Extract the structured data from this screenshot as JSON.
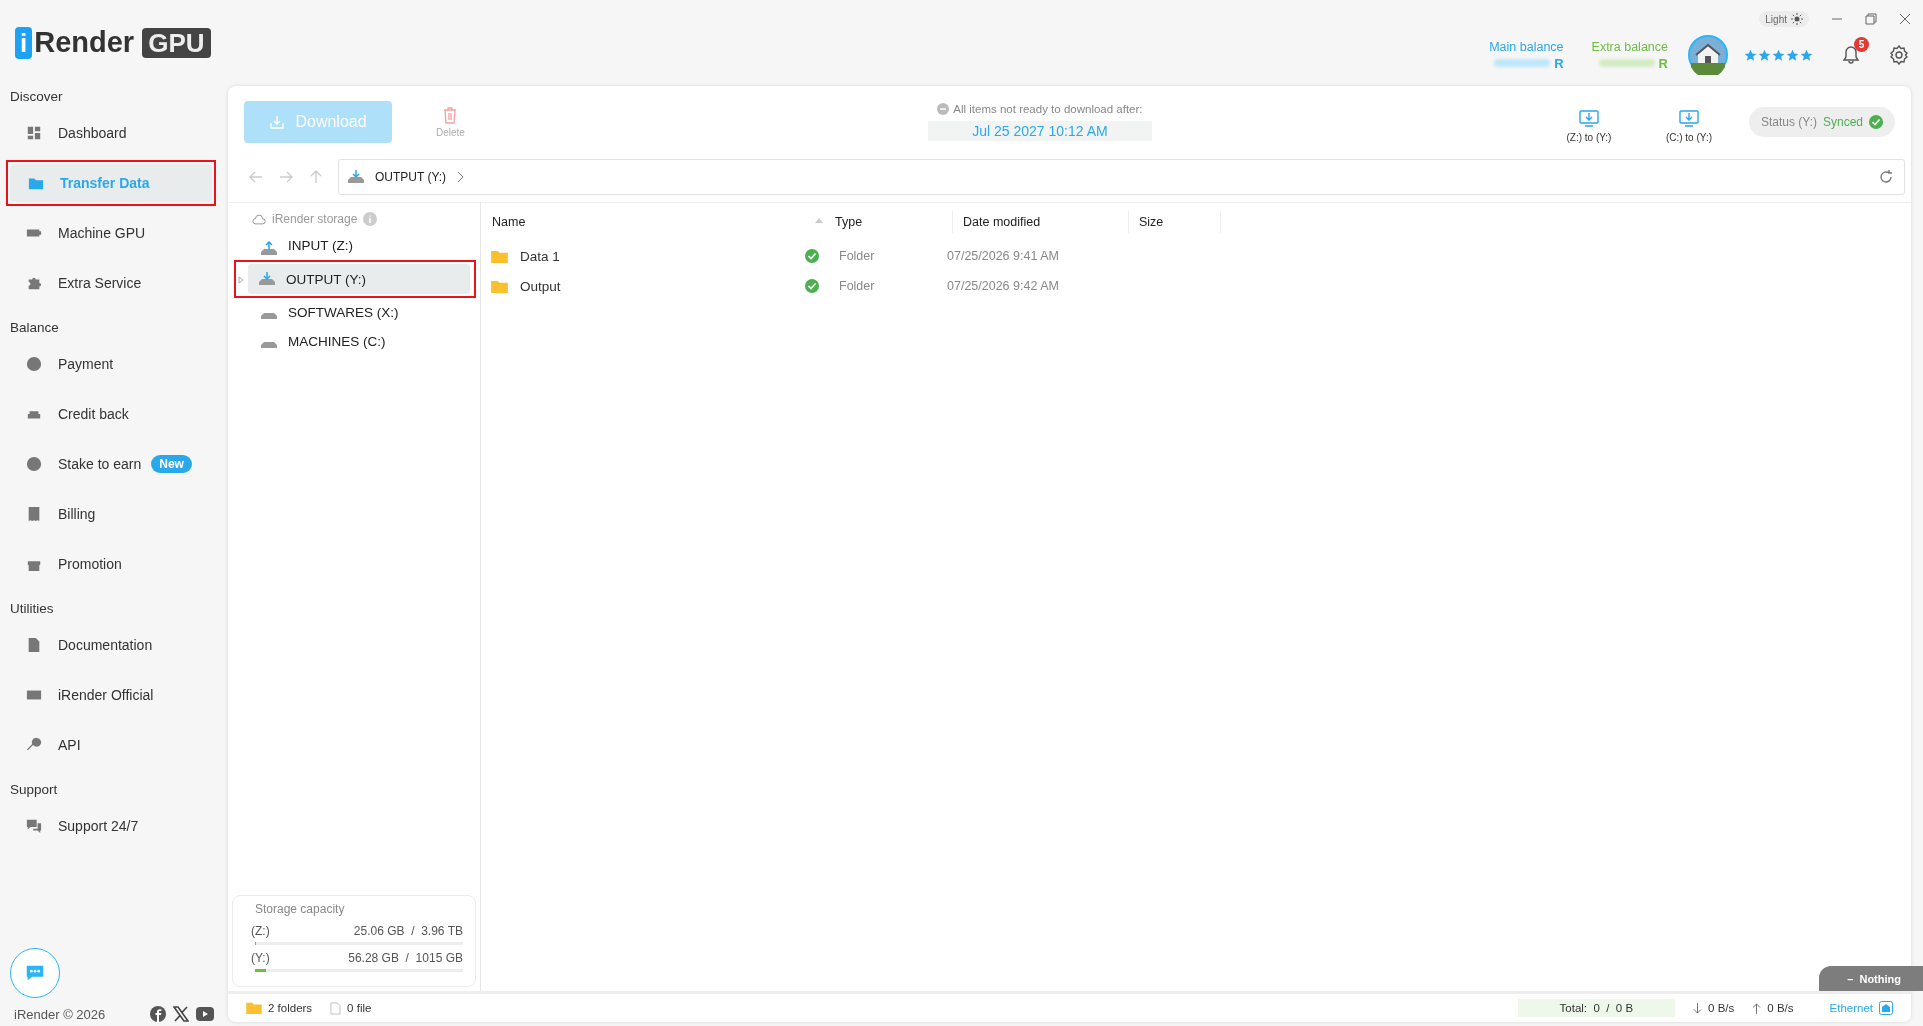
{
  "brand": {
    "logo_letter": "i",
    "logo_word": "Render",
    "logo_badge": "GPU"
  },
  "window_controls": {
    "theme_label": "Light"
  },
  "header": {
    "main_balance_label": "Main balance",
    "main_currency": "R",
    "extra_balance_label": "Extra balance",
    "extra_currency": "R",
    "stars": 5,
    "notifications": "5"
  },
  "sidebar": {
    "sections": [
      {
        "title": "Discover",
        "items": [
          {
            "label": "Dashboard",
            "selected": false
          },
          {
            "label": "Transfer Data",
            "selected": true
          },
          {
            "label": "Machine GPU",
            "selected": false
          },
          {
            "label": "Extra Service",
            "selected": false
          }
        ]
      },
      {
        "title": "Balance",
        "items": [
          {
            "label": "Payment",
            "selected": false
          },
          {
            "label": "Credit back",
            "selected": false
          },
          {
            "label": "Stake to earn",
            "selected": false,
            "badge": "New"
          },
          {
            "label": "Billing",
            "selected": false
          },
          {
            "label": "Promotion",
            "selected": false
          }
        ]
      },
      {
        "title": "Utilities",
        "items": [
          {
            "label": "Documentation",
            "selected": false
          },
          {
            "label": "iRender Official",
            "selected": false
          },
          {
            "label": "API",
            "selected": false
          }
        ]
      },
      {
        "title": "Support",
        "items": [
          {
            "label": "Support 24/7",
            "selected": false
          }
        ]
      }
    ],
    "footer": "iRender © 2026"
  },
  "toolbar": {
    "download": "Download",
    "delete": "Delete",
    "notice": "All items not ready to download after:",
    "deadline": "Jul 25 2027 10:12 AM",
    "sync_buttons": [
      "(Z:) to (Y:)",
      "(C:) to (Y:)"
    ],
    "status_label": "Status (Y:)",
    "status_value": "Synced"
  },
  "address_bar": {
    "path": "OUTPUT (Y:)"
  },
  "tree": {
    "root": "iRender storage",
    "drives": [
      {
        "label": "INPUT (Z:)",
        "kind": "upload",
        "selected": false
      },
      {
        "label": "OUTPUT (Y:)",
        "kind": "download",
        "selected": true
      },
      {
        "label": "SOFTWARES (X:)",
        "kind": "plain",
        "selected": false
      },
      {
        "label": "MACHINES (C:)",
        "kind": "plain",
        "selected": false
      }
    ]
  },
  "table": {
    "columns": [
      "Name",
      "Type",
      "Date modified",
      "Size"
    ],
    "rows": [
      {
        "name": "Data 1",
        "synced": true,
        "type": "Folder",
        "date": "07/25/2026 9:41 AM"
      },
      {
        "name": "Output",
        "synced": true,
        "type": "Folder",
        "date": "07/25/2026 9:42 AM"
      }
    ]
  },
  "storage": {
    "title": "Storage capacity",
    "drives": [
      {
        "drive": "(Z:)",
        "usage": "25.06 GB  /  3.96 TB",
        "level": 0.006
      },
      {
        "drive": "(Y:)",
        "usage": "56.28 GB  /  1015 GB",
        "level": 0.055
      }
    ]
  },
  "nothing_tab": {
    "mark": "–",
    "label": "Nothing"
  },
  "status_bar": {
    "folders": "2 folders",
    "files": "0 file",
    "total": "Total:  0  /  0 B",
    "down": "0 B/s",
    "up": "0 B/s",
    "network": "Ethernet"
  }
}
